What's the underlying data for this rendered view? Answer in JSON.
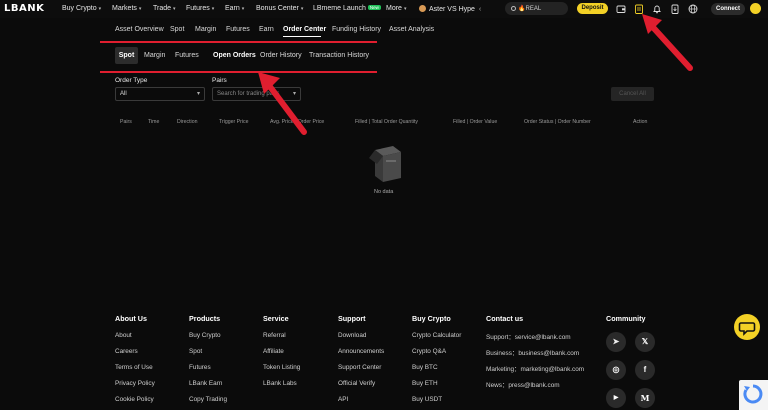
{
  "nav": {
    "logo": "LBANK",
    "items": [
      {
        "label": "Buy Crypto",
        "chevron": true
      },
      {
        "label": "Markets",
        "chevron": true
      },
      {
        "label": "Trade",
        "chevron": true
      },
      {
        "label": "Futures",
        "chevron": true
      },
      {
        "label": "Earn",
        "chevron": true
      },
      {
        "label": "Bonus Center",
        "chevron": true
      },
      {
        "label": "LBmeme Launch",
        "badge": "New"
      },
      {
        "label": "More",
        "chevron": true
      },
      {
        "label": "Aster VS Hype",
        "suffix": "‹"
      }
    ],
    "search_text": "REAL",
    "deposit": "Deposit",
    "connect": "Connect",
    "chevron_glyph": "▾",
    "icons": [
      "wallet-icon",
      "orders-icon",
      "bell-icon",
      "download-icon",
      "globe-icon"
    ]
  },
  "asset_tabs": [
    {
      "label": "Asset Overview"
    },
    {
      "label": "Spot"
    },
    {
      "label": "Margin"
    },
    {
      "label": "Futures"
    },
    {
      "label": "Earn"
    },
    {
      "label": "Order Center",
      "active": true
    },
    {
      "label": "Funding History"
    },
    {
      "label": "Asset Analysis"
    }
  ],
  "sub_tabs_left": [
    {
      "label": "Spot",
      "active": true
    },
    {
      "label": "Margin"
    },
    {
      "label": "Futures"
    }
  ],
  "sub_tabs_right": [
    {
      "label": "Open Orders",
      "active": true
    },
    {
      "label": "Order History"
    },
    {
      "label": "Transaction History"
    }
  ],
  "filters": {
    "order_type_label": "Order Type",
    "order_type_value": "All",
    "pairs_label": "Pairs",
    "pairs_placeholder": "Search for trading pairs",
    "cancel_all": "Cancel All"
  },
  "table": {
    "headers": [
      "Pairs",
      "Time",
      "Direction",
      "Trigger Price",
      "Avg. Price | Order Price",
      "Filled | Total Order Quantity",
      "Filled | Order Value",
      "Order Status | Order Number",
      "Action"
    ],
    "empty_text": "No data"
  },
  "footer": {
    "columns": [
      {
        "title": "About Us",
        "links": [
          "About",
          "Careers",
          "Terms of Use",
          "Privacy Policy",
          "Cookie Policy"
        ]
      },
      {
        "title": "Products",
        "links": [
          "Buy Crypto",
          "Spot",
          "Futures",
          "LBank Earn",
          "Copy Trading"
        ]
      },
      {
        "title": "Service",
        "links": [
          "Referral",
          "Affiliate",
          "Token Listing",
          "LBank Labs"
        ]
      },
      {
        "title": "Support",
        "links": [
          "Download",
          "Announcements",
          "Support Center",
          "Official Verify",
          "API"
        ]
      },
      {
        "title": "Buy Crypto",
        "links": [
          "Crypto Calculator",
          "Crypto Q&A",
          "Buy BTC",
          "Buy ETH",
          "Buy USDT"
        ]
      },
      {
        "title": "Contact us",
        "links": [
          "Support：service@lbank.com",
          "Business：business@lbank.com",
          "Marketing：marketing@lbank.com",
          "News：press@lbank.com"
        ]
      }
    ],
    "community_title": "Community",
    "social": [
      {
        "name": "telegram-icon",
        "glyph": "➤"
      },
      {
        "name": "x-icon",
        "glyph": "𝕏"
      },
      {
        "name": "instagram-icon",
        "glyph": "◎"
      },
      {
        "name": "facebook-icon",
        "glyph": "f"
      },
      {
        "name": "youtube-icon",
        "glyph": "▶"
      },
      {
        "name": "medium-icon",
        "glyph": "M"
      }
    ]
  },
  "colors": {
    "accent": "#f3d126",
    "annotation": "#e01e2f",
    "background": "#0b0b0b"
  }
}
